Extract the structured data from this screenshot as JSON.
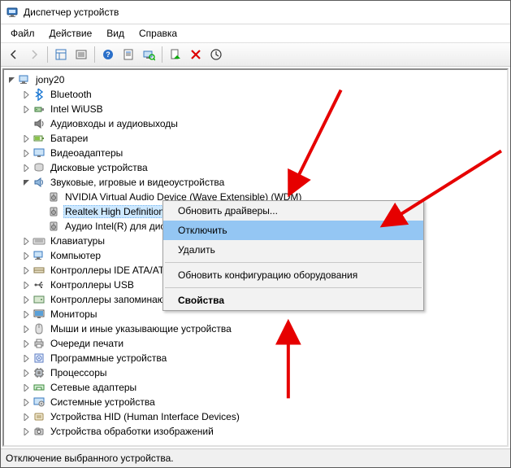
{
  "title": "Диспетчер устройств",
  "menu": {
    "file": "Файл",
    "action": "Действие",
    "view": "Вид",
    "help": "Справка"
  },
  "status": "Отключение выбранного устройства.",
  "tree": {
    "root": "jony20",
    "items": [
      {
        "label": "Bluetooth",
        "icon": "bt",
        "open": false
      },
      {
        "label": "Intel WiUSB",
        "icon": "usb",
        "open": false
      },
      {
        "label": "Аудиовходы и аудиовыходы",
        "icon": "audio",
        "open": false,
        "leaf": true
      },
      {
        "label": "Батареи",
        "icon": "battery",
        "open": false
      },
      {
        "label": "Видеоадаптеры",
        "icon": "display",
        "open": false
      },
      {
        "label": "Дисковые устройства",
        "icon": "disk",
        "open": false
      },
      {
        "label": "Звуковые, игровые и видеоустройства",
        "icon": "sound",
        "open": true,
        "children": [
          {
            "label": "NVIDIA Virtual Audio Device (Wave Extensible) (WDM)",
            "icon": "speaker"
          },
          {
            "label": "Realtek High Definition A",
            "icon": "speaker",
            "selected": true
          },
          {
            "label": "Аудио Intel(R) для диспл",
            "icon": "speaker"
          }
        ]
      },
      {
        "label": "Клавиатуры",
        "icon": "keyboard",
        "open": false
      },
      {
        "label": "Компьютер",
        "icon": "computer",
        "open": false
      },
      {
        "label": "Контроллеры IDE ATA/ATA",
        "icon": "ide",
        "open": false
      },
      {
        "label": "Контроллеры USB",
        "icon": "usbctl",
        "open": false
      },
      {
        "label": "Контроллеры запоминающ",
        "icon": "storage",
        "open": false
      },
      {
        "label": "Мониторы",
        "icon": "monitor",
        "open": false
      },
      {
        "label": "Мыши и иные указывающие устройства",
        "icon": "mouse",
        "open": false
      },
      {
        "label": "Очереди печати",
        "icon": "print",
        "open": false
      },
      {
        "label": "Программные устройства",
        "icon": "soft",
        "open": false
      },
      {
        "label": "Процессоры",
        "icon": "cpu",
        "open": false
      },
      {
        "label": "Сетевые адаптеры",
        "icon": "net",
        "open": false
      },
      {
        "label": "Системные устройства",
        "icon": "system",
        "open": false
      },
      {
        "label": "Устройства HID (Human Interface Devices)",
        "icon": "hid",
        "open": false
      },
      {
        "label": "Устройства обработки изображений",
        "icon": "imaging",
        "open": false
      }
    ]
  },
  "context_menu": {
    "items": [
      {
        "label": "Обновить драйверы...",
        "type": "item"
      },
      {
        "label": "Отключить",
        "type": "item",
        "selected": true
      },
      {
        "label": "Удалить",
        "type": "item"
      },
      {
        "type": "sep"
      },
      {
        "label": "Обновить конфигурацию оборудования",
        "type": "item"
      },
      {
        "type": "sep"
      },
      {
        "label": "Свойства",
        "type": "item",
        "bold": true
      }
    ]
  }
}
